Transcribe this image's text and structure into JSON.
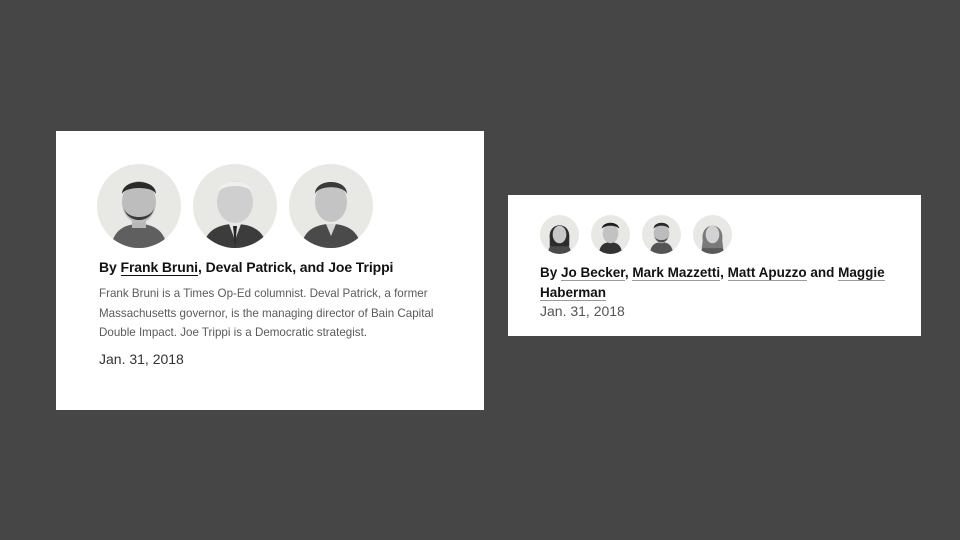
{
  "card1": {
    "avatars": [
      {
        "icon": "author-portrait-icon",
        "alt": "Frank Bruni"
      },
      {
        "icon": "author-portrait-icon",
        "alt": "Deval Patrick"
      },
      {
        "icon": "author-portrait-icon",
        "alt": "Joe Trippi"
      }
    ],
    "byline": {
      "prefix": "By ",
      "author1": "Frank Bruni",
      "sep1": ", ",
      "author2": "Deval Patrick",
      "sep2": ", and ",
      "author3": "Joe Trippi"
    },
    "bio": "Frank Bruni is a Times Op-Ed columnist. Deval Patrick, a former Massachusetts governor, is the managing director of Bain Capital Double Impact. Joe Trippi is a Democratic strategist.",
    "date": "Jan. 31, 2018"
  },
  "card2": {
    "avatars": [
      {
        "icon": "author-portrait-icon",
        "alt": "Jo Becker"
      },
      {
        "icon": "author-portrait-icon",
        "alt": "Mark Mazzetti"
      },
      {
        "icon": "author-portrait-icon",
        "alt": "Matt Apuzzo"
      },
      {
        "icon": "author-portrait-icon",
        "alt": "Maggie Haberman"
      }
    ],
    "byline": {
      "prefix": "By ",
      "author1": "Jo Becker",
      "sep1": ", ",
      "author2": "Mark Mazzetti",
      "sep2": ", ",
      "author3": "Matt Apuzzo",
      "sep3": " and ",
      "author4": "Maggie Haberman"
    },
    "date": "Jan. 31, 2018"
  },
  "colors": {
    "background": "#464646",
    "card": "#ffffff",
    "avatar_bg": "#e8e8e4",
    "text": "#121212",
    "muted": "#5a5a5a"
  }
}
